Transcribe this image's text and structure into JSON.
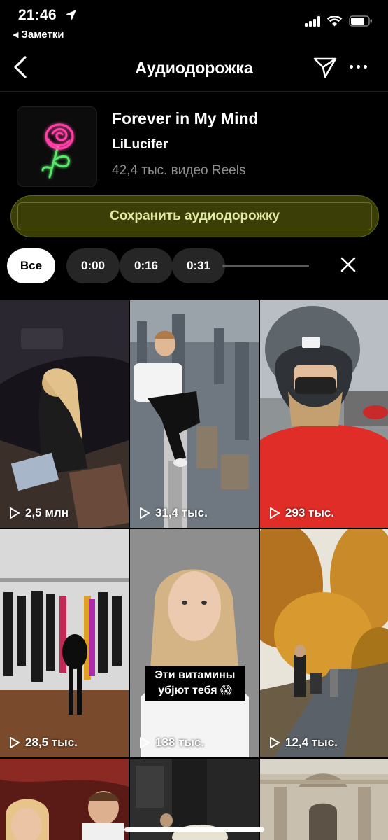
{
  "status_bar": {
    "time": "21:46",
    "back_app": "Заметки"
  },
  "nav": {
    "title": "Аудиодорожка"
  },
  "track": {
    "title": "Forever in My Mind",
    "artist": "LiLucifer",
    "reels_count": "42,4 тыс. видео Reels",
    "save_label": "Сохранить аудиодорожку"
  },
  "filters": {
    "all": "Все",
    "times": [
      "0:00",
      "0:16",
      "0:31"
    ]
  },
  "reels": [
    {
      "views": "2,5 млн"
    },
    {
      "views": "31,4 тыс."
    },
    {
      "views": "293 тыс."
    },
    {
      "views": "28,5 тыс."
    },
    {
      "views": "138 тыс.",
      "caption_line1": "Эти витамины",
      "caption_line2": "убјют тебя 😱"
    },
    {
      "views": "12,4 тыс."
    },
    {
      "views": ""
    },
    {
      "views": ""
    },
    {
      "views": ""
    }
  ],
  "colors": {
    "accent_bg": "#3b3f07",
    "accent_text": "#e1e9a3",
    "chip_bg": "#262626"
  }
}
